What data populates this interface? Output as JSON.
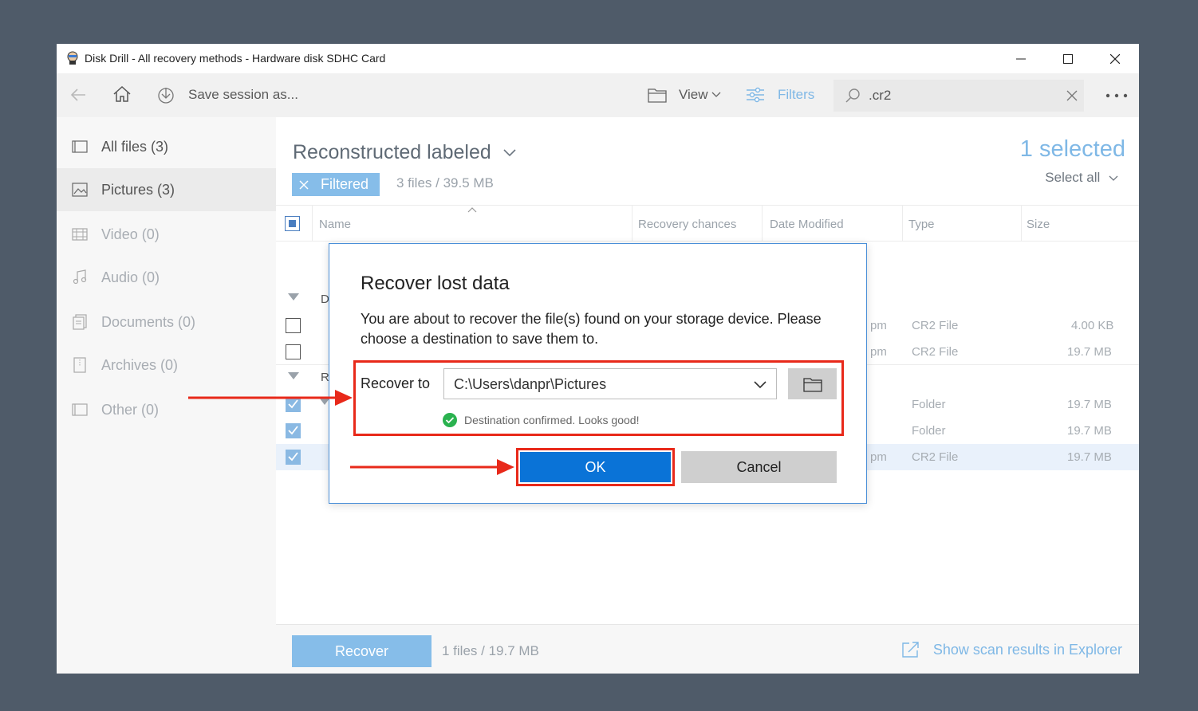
{
  "window": {
    "title": "Disk Drill - All recovery methods - Hardware disk SDHC Card"
  },
  "toolbar": {
    "save_session": "Save session as...",
    "view": "View",
    "filters": "Filters",
    "search_value": ".cr2"
  },
  "sidebar": {
    "items": [
      {
        "label": "All files (3)",
        "icon": "all-files-icon"
      },
      {
        "label": "Pictures (3)",
        "icon": "pictures-icon"
      },
      {
        "label": "Video (0)",
        "icon": "video-icon"
      },
      {
        "label": "Audio (0)",
        "icon": "audio-icon"
      },
      {
        "label": "Documents (0)",
        "icon": "documents-icon"
      },
      {
        "label": "Archives (0)",
        "icon": "archives-icon"
      },
      {
        "label": "Other (0)",
        "icon": "other-icon"
      }
    ]
  },
  "main": {
    "heading": "Reconstructed labeled",
    "filter_chip": "Filtered",
    "summary": "3 files / 39.5 MB",
    "selected": "1 selected",
    "select_all": "Select all",
    "columns": [
      "Name",
      "Recovery chances",
      "Date Modified",
      "Type",
      "Size"
    ],
    "group_letters": [
      "D",
      "R"
    ],
    "rows": [
      {
        "date": "pm",
        "type": "CR2 File",
        "size": "4.00 KB"
      },
      {
        "date": "pm",
        "type": "CR2 File",
        "size": "19.7 MB"
      },
      {
        "date": "",
        "type": "Folder",
        "size": "19.7 MB"
      },
      {
        "date": "",
        "type": "Folder",
        "size": "19.7 MB"
      },
      {
        "date": "pm",
        "type": "CR2 File",
        "size": "19.7 MB"
      }
    ]
  },
  "footer": {
    "recover": "Recover",
    "summary": "1 files / 19.7 MB",
    "explorer": "Show scan results in Explorer"
  },
  "dialog": {
    "title": "Recover lost data",
    "message": "You are about to recover the file(s) found on your storage device. Please choose a destination to save them to.",
    "recover_to_label": "Recover to",
    "destination": "C:\\Users\\danpr\\Pictures",
    "confirm": "Destination confirmed. Looks good!",
    "ok": "OK",
    "cancel": "Cancel"
  },
  "colors": {
    "accent": "#0a73d7",
    "annotation": "#e8291a",
    "success": "#2ab24f",
    "light_accent": "#86bde9"
  }
}
